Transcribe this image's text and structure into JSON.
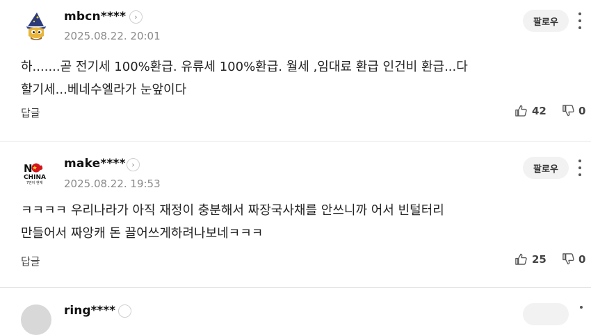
{
  "comments": [
    {
      "username": "mbcn****",
      "timestamp": "2025.08.22. 20:01",
      "follow_label": "팔로우",
      "text_line1": "하.......곧 전기세 100%환급. 유류세 100%환급. 월세 ,임대료 환급 인건비 환급...다",
      "text_line2": "할기세...베네수엘라가 눈앞이다",
      "reply_label": "답글",
      "likes": "42",
      "dislikes": "0",
      "avatar_icon": "wizard-character-icon"
    },
    {
      "username": "make****",
      "timestamp": "2025.08.22. 19:53",
      "follow_label": "팔로우",
      "text_line1": "ㅋㅋㅋㅋ 우리나라가 아직 재정이 충분해서 짜장국사채를 안쓰니까 어서 빈털터리",
      "text_line2": "만들어서 짜앙캐 돈 끌어쓰게하려나보네ㅋㅋㅋ",
      "reply_label": "답글",
      "likes": "25",
      "dislikes": "0",
      "avatar_icon": "no-china-badge-icon",
      "avatar_text_main": "CHINA",
      "avatar_text_sub": "7번이 현재"
    },
    {
      "username": "ring****"
    }
  ],
  "colors": {
    "text": "#222222",
    "muted": "#8a8a8a",
    "button_bg": "#f2f2f2",
    "divider": "#e5e5e5",
    "china_red": "#d4161c"
  }
}
